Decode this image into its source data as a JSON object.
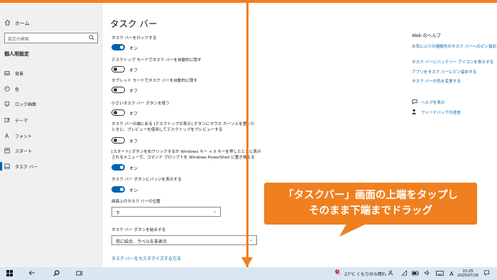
{
  "sidebar": {
    "home_label": "ホーム",
    "search_placeholder": "設定の検索",
    "section_title": "個人用設定",
    "items": [
      {
        "label": "背景",
        "icon": "image-icon"
      },
      {
        "label": "色",
        "icon": "palette-icon"
      },
      {
        "label": "ロック画面",
        "icon": "lock-screen-icon"
      },
      {
        "label": "テーマ",
        "icon": "theme-brush-icon"
      },
      {
        "label": "フォント",
        "icon": "font-icon"
      },
      {
        "label": "スタート",
        "icon": "start-grid-icon"
      },
      {
        "label": "タスク バー",
        "icon": "taskbar-icon",
        "active": true
      }
    ]
  },
  "main": {
    "title": "タスク バー",
    "settings": [
      {
        "label": "タスク バーをロックする",
        "state": "オン",
        "on": true
      },
      {
        "label": "デスクトップ モードでタスク バーを自動的に隠す",
        "state": "オフ",
        "on": false
      },
      {
        "label": "タブレット モードでタスク バーを自動的に隠す",
        "state": "オフ",
        "on": false
      },
      {
        "label": "小さいタスク バー ボタンを使う",
        "state": "オフ",
        "on": false
      },
      {
        "label": "タスク バーの端にある [デスクトップの表示] ボタンにマウス カーソルを置いたときに、プレビューを使用してデスクトップをプレビューする",
        "state": "オフ",
        "on": false
      },
      {
        "label": "[スタート] ボタンを右クリックするか Windows キー + X キーを押したときに表示されるメニューで、コマンド プロンプトを Windows PowerShell に置き換える",
        "state": "オン",
        "on": true
      },
      {
        "label": "タスク バー ボタンにバッジを表示する",
        "state": "オン",
        "on": true
      }
    ],
    "position_label": "画面上のタスク バーの位置",
    "position_value": "下",
    "combine_label": "タスク バー ボタンを結合する",
    "combine_value": "常に結合、ラベルを非表示",
    "customize_link": "タスク バーをカスタマイズする方法"
  },
  "help_panel": {
    "title": "Web のヘルプ",
    "links": [
      "お気に入りの連絡先のタスク バーへのピン留め",
      "タスク バーにバッテリー アイコンを表示する",
      "アプリをタスク バーにピン留めする",
      "タスク バーの色を変更する"
    ],
    "get_help": "ヘルプを表示",
    "feedback": "フィードバックの送信"
  },
  "callout": {
    "line1": "「タスクバー」画面の上端をタップし",
    "line2": "そのまま下端までドラッグ"
  },
  "taskbar": {
    "weather_badge": "1",
    "weather": "27°C くもりのち晴れ",
    "ime": "A",
    "time": "15:25",
    "date": "2025/07/16"
  },
  "colors": {
    "accent": "#0063b1",
    "callout": "#f07f1f",
    "taskbar_bg": "#dbe6f3"
  }
}
